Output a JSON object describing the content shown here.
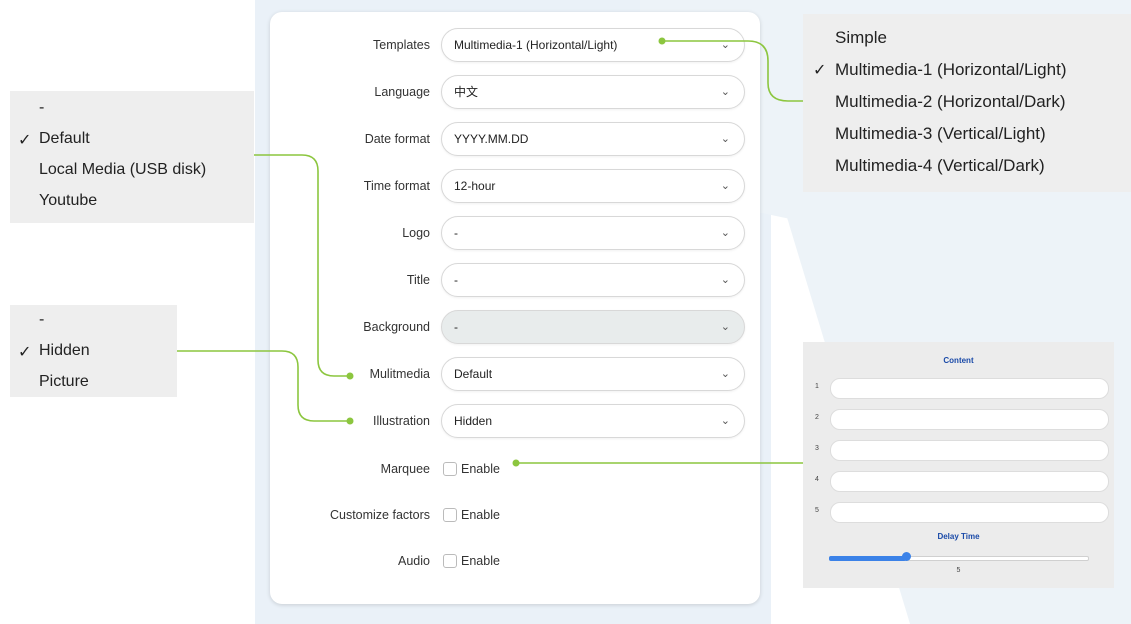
{
  "form": {
    "rows": [
      {
        "label": "Templates",
        "type": "select",
        "value": "Multimedia-1 (Horizontal/Light)"
      },
      {
        "label": "Language",
        "type": "select",
        "value": "中文"
      },
      {
        "label": "Date format",
        "type": "select",
        "value": "YYYY.MM.DD"
      },
      {
        "label": "Time format",
        "type": "select",
        "value": "12-hour"
      },
      {
        "label": "Logo",
        "type": "select",
        "value": "-"
      },
      {
        "label": "Title",
        "type": "select",
        "value": "-"
      },
      {
        "label": "Background",
        "type": "select",
        "value": "-",
        "disabled": true
      },
      {
        "label": "Mulitmedia",
        "type": "select",
        "value": "Default"
      },
      {
        "label": "Illustration",
        "type": "select",
        "value": "Hidden"
      },
      {
        "label": "Marquee",
        "type": "checkbox",
        "value": "Enable"
      },
      {
        "label": "Customize factors",
        "type": "checkbox",
        "value": "Enable"
      },
      {
        "label": "Audio",
        "type": "checkbox",
        "value": "Enable"
      }
    ]
  },
  "templates_menu": {
    "items": [
      "Simple",
      "Multimedia-1 (Horizontal/Light)",
      "Multimedia-2 (Horizontal/Dark)",
      "Multimedia-3 (Vertical/Light)",
      "Multimedia-4 (Vertical/Dark)"
    ],
    "selected_index": 1,
    "check_mark": "✓"
  },
  "multimedia_menu": {
    "items": [
      "-",
      "Default",
      "Local Media (USB disk)",
      "Youtube"
    ],
    "selected_index": 1,
    "check_mark": "✓"
  },
  "illustration_menu": {
    "items": [
      "-",
      "Hidden",
      "Picture"
    ],
    "selected_index": 1,
    "check_mark": "✓"
  },
  "marquee_content": {
    "title": "Content",
    "fields": [
      "1",
      "2",
      "3",
      "4",
      "5"
    ],
    "delay_label": "Delay Time",
    "delay_value": "5",
    "delay_fraction": 0.3
  },
  "colors": {
    "connector": "#8cc63f",
    "accent": "#3b82e8",
    "content_title": "#1a4aa8"
  },
  "icons": {
    "chevron": "chevron-down-icon"
  }
}
